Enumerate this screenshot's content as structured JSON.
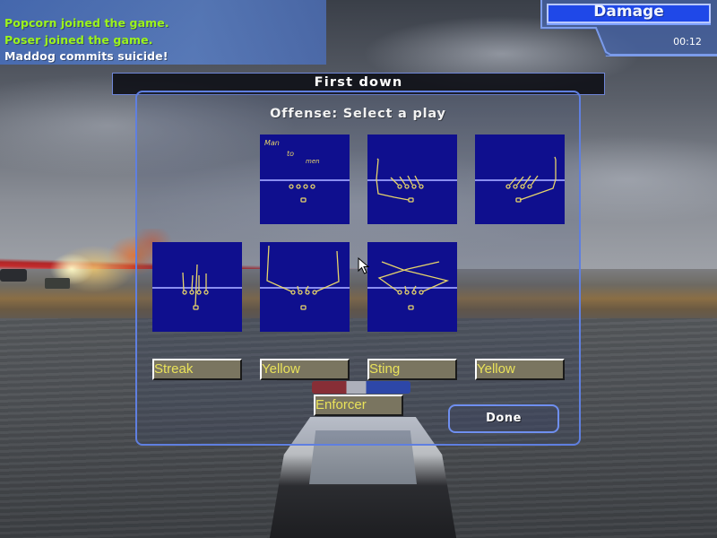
{
  "chat": {
    "messages": [
      {
        "text": "Popcorn joined the game.",
        "color": "#9cf41c"
      },
      {
        "text": "Poser joined the game.",
        "color": "#9cf41c"
      },
      {
        "text": "Maddog commits suicide!",
        "color": "#ffffff"
      }
    ]
  },
  "hud": {
    "damage_label": "Damage",
    "timer": "00:12"
  },
  "banner": {
    "title": "First down"
  },
  "dialog": {
    "title": "Offense: Select a play",
    "plays": [
      {
        "id": "play-1",
        "diagram": "man-to-man-note",
        "note": [
          "Man",
          "to",
          "men"
        ]
      },
      {
        "id": "play-2",
        "diagram": "left-sweep-slants"
      },
      {
        "id": "play-3",
        "diagram": "right-sweep-slants"
      },
      {
        "id": "play-4",
        "diagram": "streak-verticals"
      },
      {
        "id": "play-5",
        "diagram": "double-flag"
      },
      {
        "id": "play-6",
        "diagram": "crossing-routes"
      }
    ],
    "player_fields": [
      {
        "value": "Streak"
      },
      {
        "value": "Yellow"
      },
      {
        "value": "Sting"
      },
      {
        "value": "Yellow"
      },
      {
        "value": "Enforcer"
      }
    ],
    "done_label": "Done"
  },
  "colors": {
    "play_card_bg": "#0f0f8e",
    "route_color": "#e6d46a",
    "scrimmage_line": "#8a8ef0",
    "field_bg": "#7a7560",
    "field_text": "#e9e25a",
    "accent": "#5f7fe0",
    "damage_fill": "#1f48e8"
  }
}
